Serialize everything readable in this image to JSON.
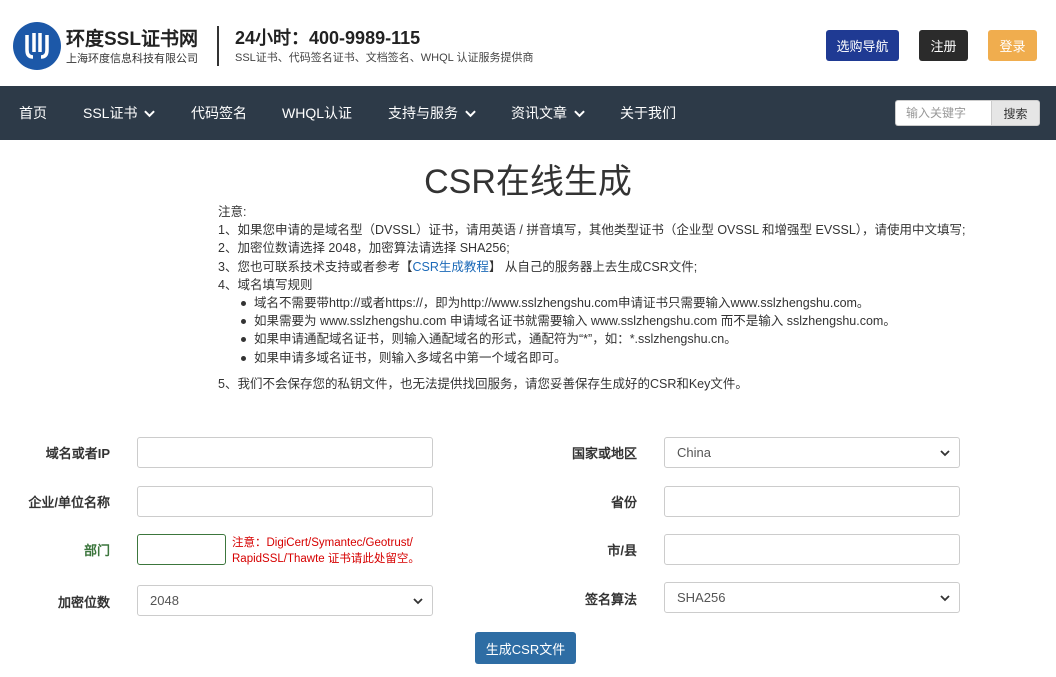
{
  "brand": {
    "name": "环度SSL证书网",
    "company": "上海环度信息科技有限公司",
    "hotline": "24小时：400-9989-115",
    "services": "SSL证书、代码签名证书、文档签名、WHQL 认证服务提供商"
  },
  "header_buttons": {
    "guide": "选购导航",
    "register": "注册",
    "login": "登录"
  },
  "nav": {
    "items": [
      {
        "label": "首页",
        "dropdown": false
      },
      {
        "label": "SSL证书",
        "dropdown": true
      },
      {
        "label": "代码签名",
        "dropdown": false
      },
      {
        "label": "WHQL认证",
        "dropdown": false
      },
      {
        "label": "支持与服务",
        "dropdown": true
      },
      {
        "label": "资讯文章",
        "dropdown": true
      },
      {
        "label": "关于我们",
        "dropdown": false
      }
    ],
    "search_placeholder": "输入关键字",
    "search_button": "搜索"
  },
  "page": {
    "title": "CSR在线生成"
  },
  "notes": {
    "heading": "注意:",
    "n1": "1、如果您申请的是域名型（DVSSL）证书，请用英语 / 拼音填写，其他类型证书（企业型 OVSSL 和增强型 EVSSL），请使用中文填写;",
    "n2": "2、加密位数请选择 2048，加密算法请选择 SHA256;",
    "n3_prefix": "3、您也可联系技术支持或者参考【",
    "n3_link": "CSR生成教程",
    "n3_suffix": "】 从自己的服务器上去生成CSR文件;",
    "n4": "4、域名填写规则",
    "bullets": [
      "域名不需要带http://或者https://，即为http://www.sslzhengshu.com申请证书只需要输入www.sslzhengshu.com。",
      "如果需要为 www.sslzhengshu.com 申请域名证书就需要输入 www.sslzhengshu.com 而不是输入 sslzhengshu.com。",
      "如果申请通配域名证书，则输入通配域名的形式，通配符为“*”，如：*.sslzhengshu.cn。",
      "如果申请多域名证书，则输入多域名中第一个域名即可。"
    ],
    "n5": "5、我们不会保存您的私钥文件，也无法提供找回服务，请您妥善保存生成好的CSR和Key文件。"
  },
  "form": {
    "domain_label": "域名或者IP",
    "domain_value": "",
    "org_label": "企业/单位名称",
    "org_value": "",
    "dept_label": "部门",
    "dept_value": "",
    "dept_warning_line1": "注意：DigiCert/Symantec/Geotrust/",
    "dept_warning_line2": "RapidSSL/Thawte 证书请此处留空。",
    "keysize_label": "加密位数",
    "keysize_value": "2048",
    "country_label": "国家或地区",
    "country_value": "China",
    "province_label": "省份",
    "province_value": "",
    "city_label": "市/县",
    "city_value": "",
    "sigalg_label": "签名算法",
    "sigalg_value": "SHA256",
    "submit": "生成CSR文件"
  },
  "colors": {
    "nav_bg": "#2d3a48",
    "guide_btn": "#1f3a93",
    "register_btn": "#2b2b2b",
    "login_btn": "#f0ad4e",
    "submit_btn": "#2e6da4",
    "warning_text": "#d60000",
    "dept_label": "#3c763d",
    "link": "#1c6ab8"
  }
}
